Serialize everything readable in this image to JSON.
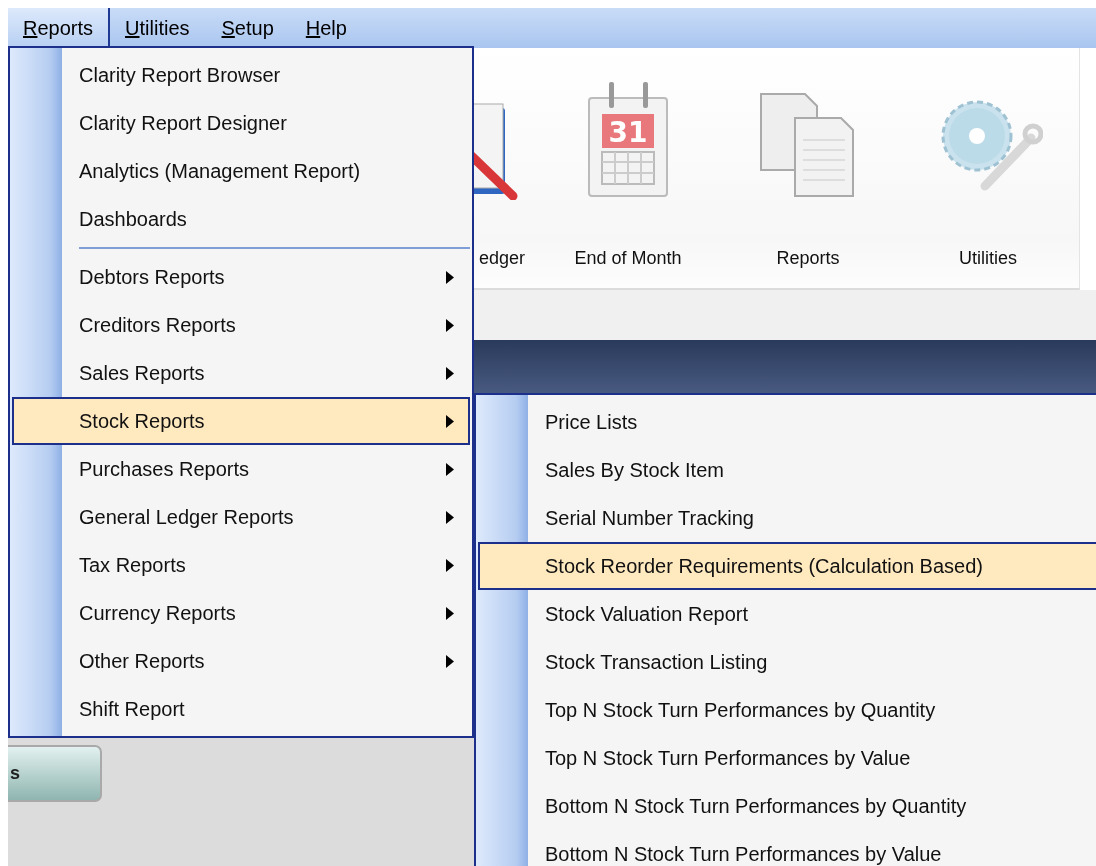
{
  "menubar": [
    {
      "label": "Reports",
      "selected": true
    },
    {
      "label": "Utilities",
      "selected": false
    },
    {
      "label": "Setup",
      "selected": false
    },
    {
      "label": "Help",
      "selected": false
    }
  ],
  "toolbar": [
    {
      "kind": "ledger",
      "label": "edger"
    },
    {
      "kind": "calendar",
      "label": "End of Month",
      "date": "31"
    },
    {
      "kind": "documents",
      "label": "Reports"
    },
    {
      "kind": "gear",
      "label": "Utilities"
    }
  ],
  "side_button": {
    "label": "s"
  },
  "reports_menu": [
    {
      "kind": "item",
      "label": "Clarity Report Browser",
      "selected": false
    },
    {
      "kind": "item",
      "label": "Clarity Report Designer",
      "selected": false
    },
    {
      "kind": "item",
      "label": "Analytics (Management Report)",
      "selected": false
    },
    {
      "kind": "item",
      "label": "Dashboards",
      "selected": false
    },
    {
      "kind": "separator"
    },
    {
      "kind": "submenu",
      "label": "Debtors Reports",
      "selected": false
    },
    {
      "kind": "submenu",
      "label": "Creditors Reports",
      "selected": false
    },
    {
      "kind": "submenu",
      "label": "Sales Reports",
      "selected": false
    },
    {
      "kind": "submenu",
      "label": "Stock Reports",
      "selected": true
    },
    {
      "kind": "submenu",
      "label": "Purchases Reports",
      "selected": false
    },
    {
      "kind": "submenu",
      "label": "General Ledger Reports",
      "selected": false
    },
    {
      "kind": "submenu",
      "label": "Tax Reports",
      "selected": false
    },
    {
      "kind": "submenu",
      "label": "Currency Reports",
      "selected": false
    },
    {
      "kind": "submenu",
      "label": "Other Reports",
      "selected": false
    },
    {
      "kind": "item",
      "label": "Shift Report",
      "selected": false
    }
  ],
  "stock_reports_menu": [
    {
      "label": "Price Lists",
      "selected": false
    },
    {
      "label": "Sales By Stock Item",
      "selected": false
    },
    {
      "label": "Serial Number Tracking",
      "selected": false
    },
    {
      "label": "Stock Reorder Requirements (Calculation Based)",
      "selected": true
    },
    {
      "label": "Stock Valuation Report",
      "selected": false
    },
    {
      "label": "Stock Transaction Listing",
      "selected": false
    },
    {
      "label": "Top N Stock Turn Performances by Quantity",
      "selected": false
    },
    {
      "label": "Top N Stock Turn Performances by Value",
      "selected": false
    },
    {
      "label": "Bottom N Stock Turn Performances by Quantity",
      "selected": false
    },
    {
      "label": "Bottom N Stock Turn Performances by Value",
      "selected": false
    }
  ]
}
